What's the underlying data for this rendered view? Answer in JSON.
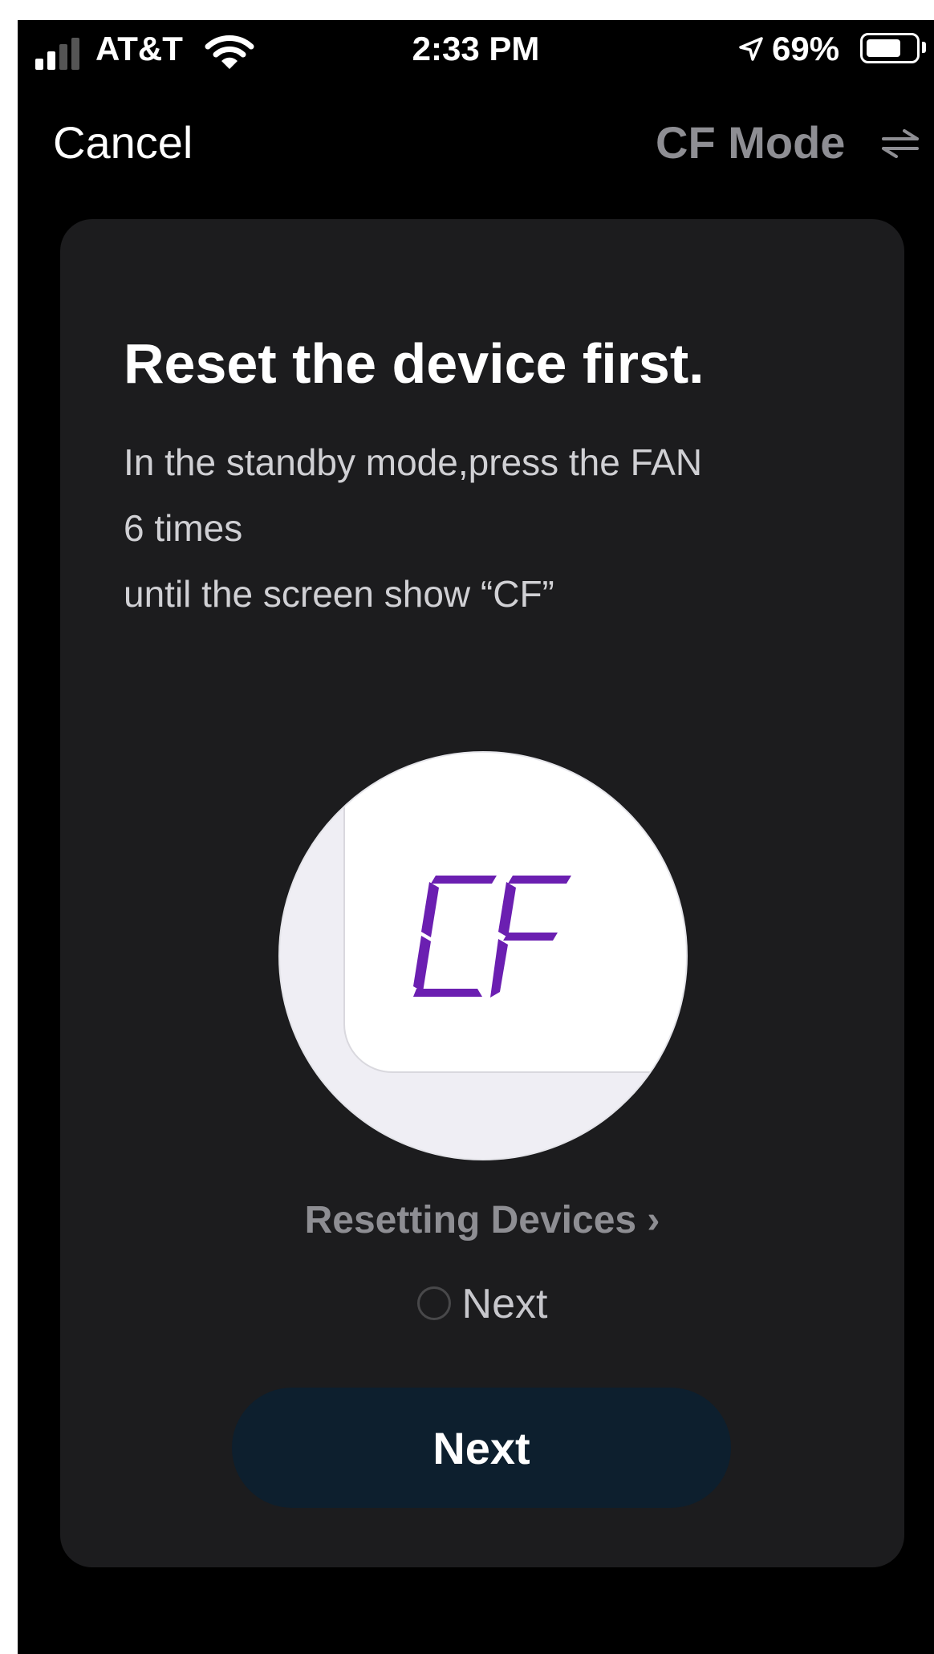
{
  "status_bar": {
    "carrier": "AT&T",
    "time": "2:33 PM",
    "battery_percent": "69%",
    "icons": [
      "signal-icon",
      "wifi-icon",
      "location-icon",
      "battery-icon"
    ]
  },
  "header": {
    "cancel_label": "Cancel",
    "mode_label": "CF Mode",
    "mode_icon": "swap-arrows-icon"
  },
  "card": {
    "title": "Reset the device first.",
    "description_lines": [
      "In the standby mode,press the FAN",
      "6 times",
      "until the screen show “CF”"
    ],
    "display_text": "CF",
    "display_color": "#6b1fb1",
    "reset_link": "Resetting Devices",
    "confirm_label": "Next",
    "next_button": "Next"
  },
  "colors": {
    "background": "#000000",
    "card": "#1c1c1e",
    "button": "#0d1f2e",
    "muted_text": "#8e8e93"
  }
}
